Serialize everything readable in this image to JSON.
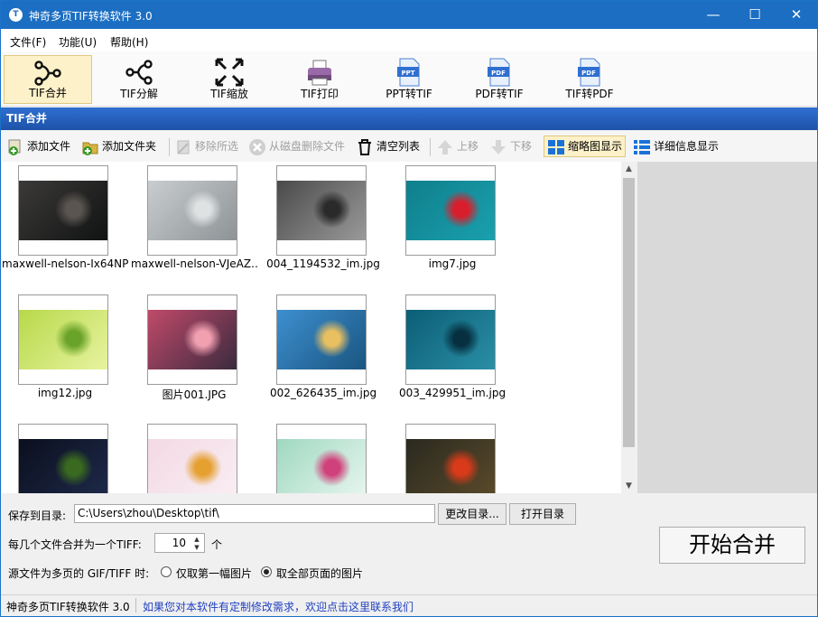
{
  "window": {
    "title": "神奇多页TIF转换软件 3.0",
    "app_icon": "TIF-app-icon",
    "minimize": "—",
    "maximize": "☐",
    "close": "✕"
  },
  "menu": [
    "文件(F)",
    "功能(U)",
    "帮助(H)"
  ],
  "toolbar": [
    {
      "label": "TIF合并",
      "icon": "merge-icon",
      "active": true
    },
    {
      "label": "TIF分解",
      "icon": "split-icon"
    },
    {
      "label": "TIF缩放",
      "icon": "scale-icon"
    },
    {
      "label": "TIF打印",
      "icon": "printer-icon"
    },
    {
      "label": "PPT转TIF",
      "icon": "ppt-file-icon",
      "badge": "PPT"
    },
    {
      "label": "PDF转TIF",
      "icon": "pdf-file-icon",
      "badge": "PDF"
    },
    {
      "label": "TIF转PDF",
      "icon": "pdf-file-icon",
      "badge": "PDF"
    }
  ],
  "section_title": "TIF合并",
  "actions": {
    "add_file": "添加文件",
    "add_folder": "添加文件夹",
    "remove_selected": "移除所选",
    "delete_from_disk": "从磁盘删除文件",
    "clear_list": "清空列表",
    "move_up": "上移",
    "move_down": "下移",
    "thumbnail_view": "缩略图显示",
    "detail_view": "详细信息显示"
  },
  "files": [
    {
      "name": "maxwell-nelson-Ix64NP…",
      "colors": [
        "#3b3a38",
        "#111213",
        "#5a5550"
      ]
    },
    {
      "name": "maxwell-nelson-VJeAZ…",
      "colors": [
        "#c9cdcf",
        "#8e9396",
        "#dfe2e3"
      ]
    },
    {
      "name": "004_1194532_im.jpg",
      "colors": [
        "#4a4a4a",
        "#9a9a9a",
        "#2a2a2a"
      ]
    },
    {
      "name": "img7.jpg",
      "colors": [
        "#0f7f8c",
        "#1aa0ae",
        "#d81e2c"
      ]
    },
    {
      "name": "img12.jpg",
      "colors": [
        "#b7d94a",
        "#e8f3a0",
        "#6aa32a"
      ]
    },
    {
      "name": "图片001.JPG",
      "colors": [
        "#c04a6a",
        "#3a2a3e",
        "#f1a0b0"
      ]
    },
    {
      "name": "002_626435_im.jpg",
      "colors": [
        "#3d8fd0",
        "#1a5580",
        "#e9c060"
      ]
    },
    {
      "name": "003_429951_im.jpg",
      "colors": [
        "#0b5e76",
        "#2a8fa6",
        "#063040"
      ]
    },
    {
      "name": "",
      "colors": [
        "#0b0f1e",
        "#1e2a4a",
        "#3a6a20"
      ]
    },
    {
      "name": "",
      "colors": [
        "#f3d9e4",
        "#f9eef3",
        "#e5a030"
      ]
    },
    {
      "name": "",
      "colors": [
        "#9fd8c0",
        "#e8f6f0",
        "#d0407a"
      ]
    },
    {
      "name": "",
      "colors": [
        "#2a2a20",
        "#5a4a2a",
        "#d83a1a"
      ]
    }
  ],
  "bottom": {
    "save_dir_label": "保存到目录:",
    "save_dir_value": "C:\\Users\\zhou\\Desktop\\tif\\",
    "change_dir": "更改目录...",
    "open_dir": "打开目录",
    "per_tiff_label": "每几个文件合并为一个TIFF:",
    "per_tiff_value": "10",
    "per_tiff_unit": "个",
    "multipage_label": "源文件为多页的 GIF/TIFF 时:",
    "option_first": "仅取第一幅图片",
    "option_all": "取全部页面的图片",
    "selected_option": "all",
    "start_button": "开始合并"
  },
  "status": {
    "app": "神奇多页TIF转换软件 3.0",
    "link": "如果您对本软件有定制修改需求，欢迎点击这里联系我们",
    "link_color": "#1f3fbf"
  }
}
